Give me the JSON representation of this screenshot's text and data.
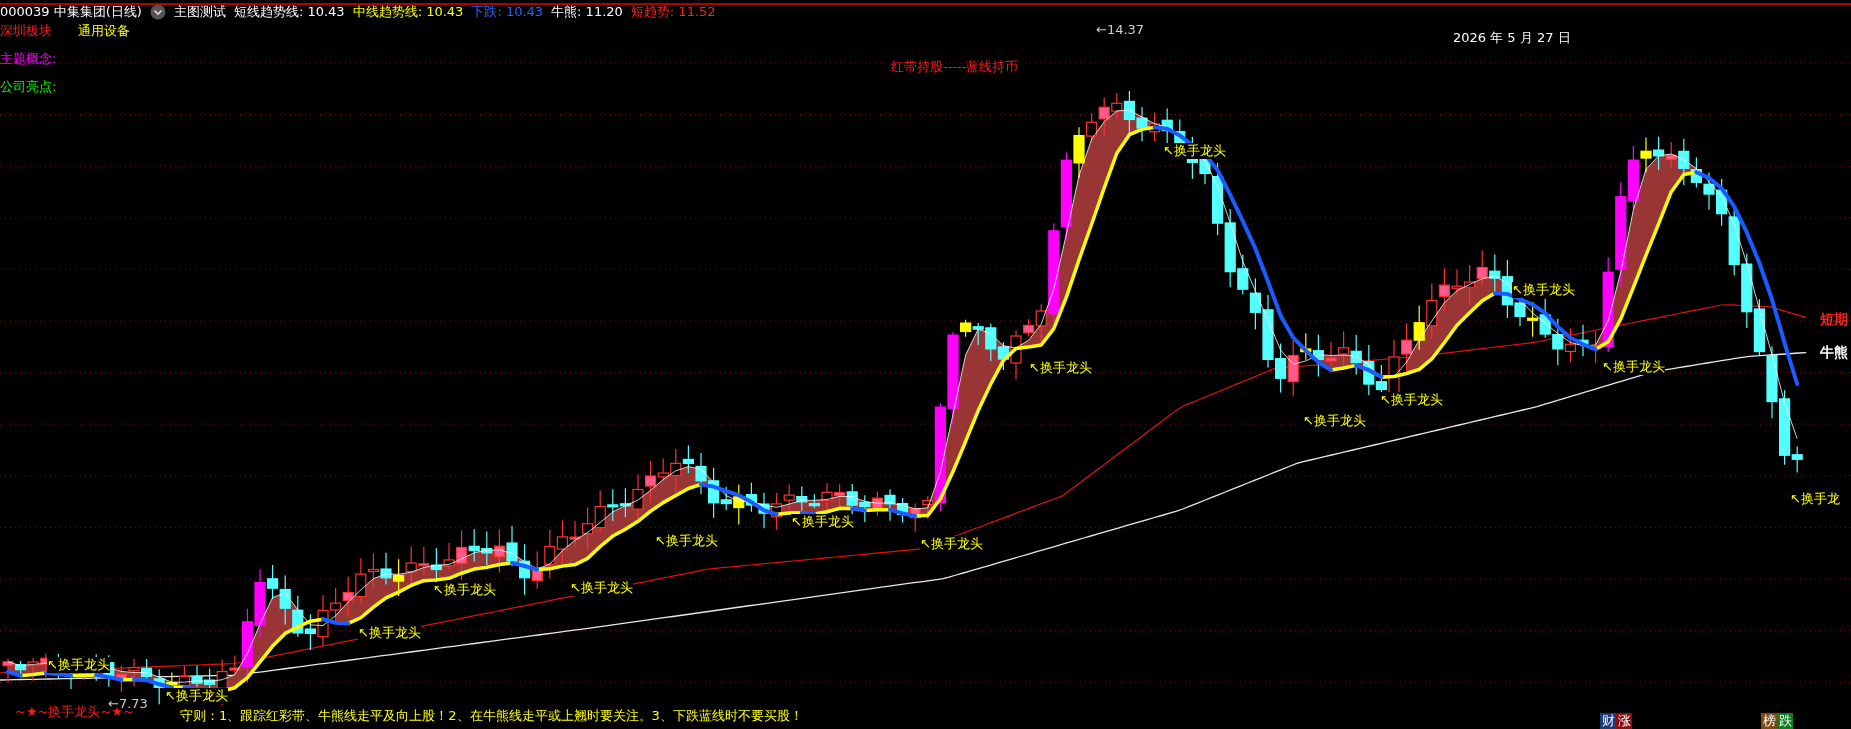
{
  "header": {
    "symbol": "000039 中集集团(日线)",
    "indicator": "主图测试",
    "readings": [
      {
        "text": "短线趋势线: 10.43",
        "color": "#ffffff"
      },
      {
        "text": "中线趋势线: 10.43",
        "color": "#ffff00"
      },
      {
        "text": "下跌: 10.43",
        "color": "#2266ff"
      },
      {
        "text": "牛熊: 11.20",
        "color": "#ffffff"
      },
      {
        "text": "短趋势: 11.52",
        "color": "#ff2020"
      }
    ]
  },
  "info": {
    "sector_label": "深圳板块",
    "sector_value": "通用设备",
    "theme_label": "主题概念:",
    "highlight_label": "公司亮点:"
  },
  "chart": {
    "caption": "红带持股-----蓝线持币",
    "high_marker": "←14.37",
    "low_marker": "←7.73",
    "date": "2026 年 5 月 27 日",
    "line_labels": [
      {
        "text": "短期",
        "color": "#ff2020"
      },
      {
        "text": "牛熊",
        "color": "#ffffff"
      }
    ],
    "signals": [
      "↖换手龙头",
      "↖换手龙头",
      "↖换手龙头",
      "↖换手龙头",
      "↖换手龙头",
      "↖换手龙头",
      "↖换手龙头",
      "↖换手龙头",
      "↖换手龙头",
      "↖换手龙头",
      "↖换手龙头",
      "↖换手龙头",
      "↖换手龙头",
      "↖换手龙头",
      "↖换手龙"
    ]
  },
  "footer": {
    "banner": "~★~换手龙头~★~",
    "rule": "守则：1、跟踪红彩带、牛熊线走平及向上股！2、在牛熊线走平或上翘时要关注。3、下跌蓝线时不要买股！",
    "tags": [
      {
        "text": "财",
        "color": "#1a3a7a"
      },
      {
        "text": "涨",
        "color": "#8a1010"
      },
      {
        "text": "榜",
        "color": "#7a4a10"
      },
      {
        "text": "跌",
        "color": "#107a20"
      }
    ]
  }
}
